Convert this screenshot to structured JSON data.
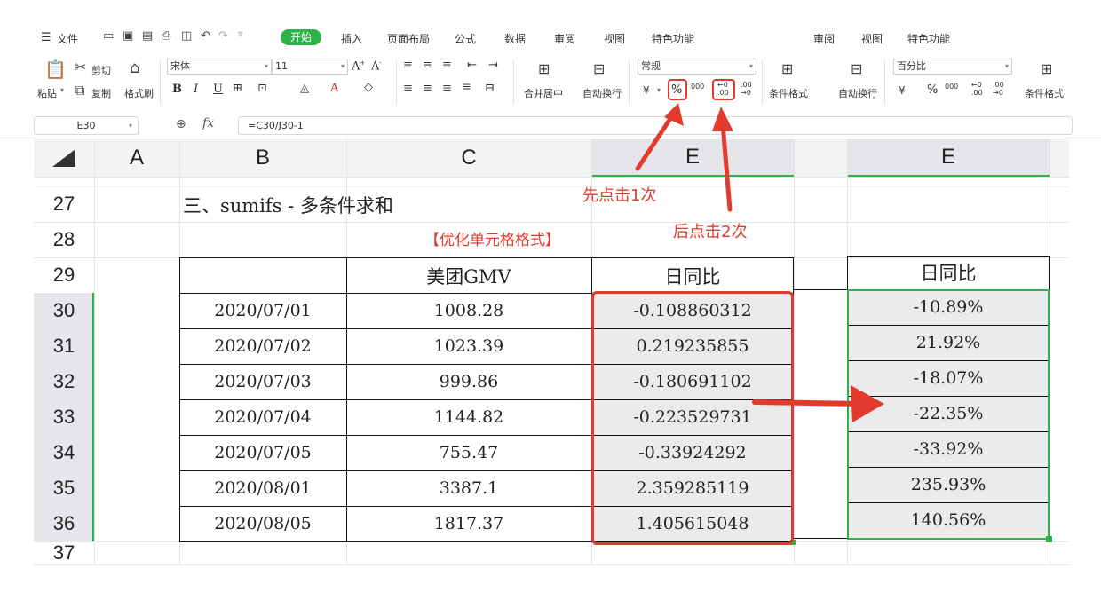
{
  "menu": {
    "hamburger": "☰",
    "file": "文件",
    "tabs": [
      "开始",
      "插入",
      "页面布局",
      "公式",
      "数据",
      "审阅",
      "视图",
      "特色功能"
    ],
    "tabs_right": [
      "审阅",
      "视图",
      "特色功能"
    ]
  },
  "ribbon": {
    "paste": "粘贴",
    "cut": "剪切",
    "copy": "复制",
    "format_painter": "格式刷",
    "font_name": "宋体",
    "font_size": "11",
    "merge_center": "合并居中",
    "wrap_text": "自动换行",
    "number_format": "常规",
    "conditional_format": "条件格式",
    "wrap_text_right": "自动换行",
    "number_format_right": "百分比",
    "conditional_format_right": "条件格式",
    "percent": "%",
    "thousands": "000",
    "currency": "¥"
  },
  "formula_bar": {
    "cell_ref": "E30",
    "fx": "fx",
    "formula": "=C30/J30-1"
  },
  "columns": [
    "A",
    "B",
    "C",
    "E",
    "E"
  ],
  "rows": [
    "27",
    "28",
    "29",
    "30",
    "31",
    "32",
    "33",
    "34",
    "35",
    "36",
    "37"
  ],
  "sheet": {
    "title": "三、sumifs - 多条件求和",
    "subtitle": "【优化单元格格式】",
    "header_c": "美团GMV",
    "header_e": "日同比",
    "header_e2": "日同比",
    "dates": [
      "2020/07/01",
      "2020/07/02",
      "2020/07/03",
      "2020/07/04",
      "2020/07/05",
      "2020/08/01",
      "2020/08/05"
    ],
    "gmv": [
      "1008.28",
      "1023.39",
      "999.86",
      "1144.82",
      "755.47",
      "3387.1",
      "1817.37"
    ],
    "ratio": [
      "-0.108860312",
      "0.219235855",
      "-0.180691102",
      "-0.223529731",
      "-0.33924292",
      "2.359285119",
      "1.405615048"
    ],
    "ratio_pct": [
      "-10.89%",
      "21.92%",
      "-18.07%",
      "-22.35%",
      "-33.92%",
      "235.93%",
      "140.56%"
    ]
  },
  "annotations": {
    "click_once": "先点击1次",
    "click_twice": "后点击2次"
  },
  "colors": {
    "accent_green": "#2fb24a",
    "annotation_red": "#e23b2e"
  }
}
